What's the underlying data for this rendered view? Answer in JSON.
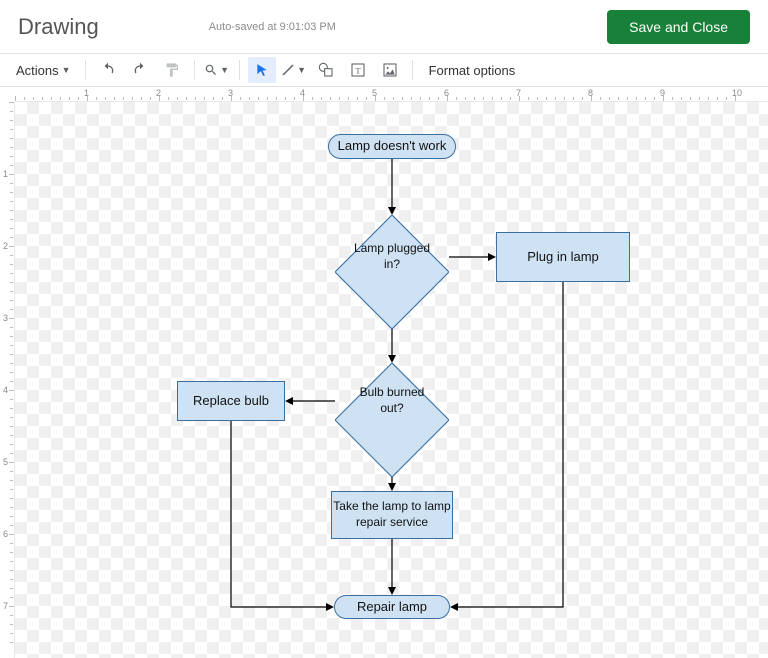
{
  "header": {
    "title": "Drawing",
    "autosave": "Auto-saved at 9:01:03 PM",
    "save_button": "Save and Close"
  },
  "toolbar": {
    "actions_label": "Actions",
    "format_options": "Format options"
  },
  "flowchart": {
    "nodes": {
      "start": "Lamp doesn't work",
      "plugged": "Lamp plugged in?",
      "plugin": "Plug in lamp",
      "burned": "Bulb burned out?",
      "replace": "Replace bulb",
      "repair_service": "Take the lamp to lamp repair service",
      "end": "Repair lamp"
    }
  }
}
